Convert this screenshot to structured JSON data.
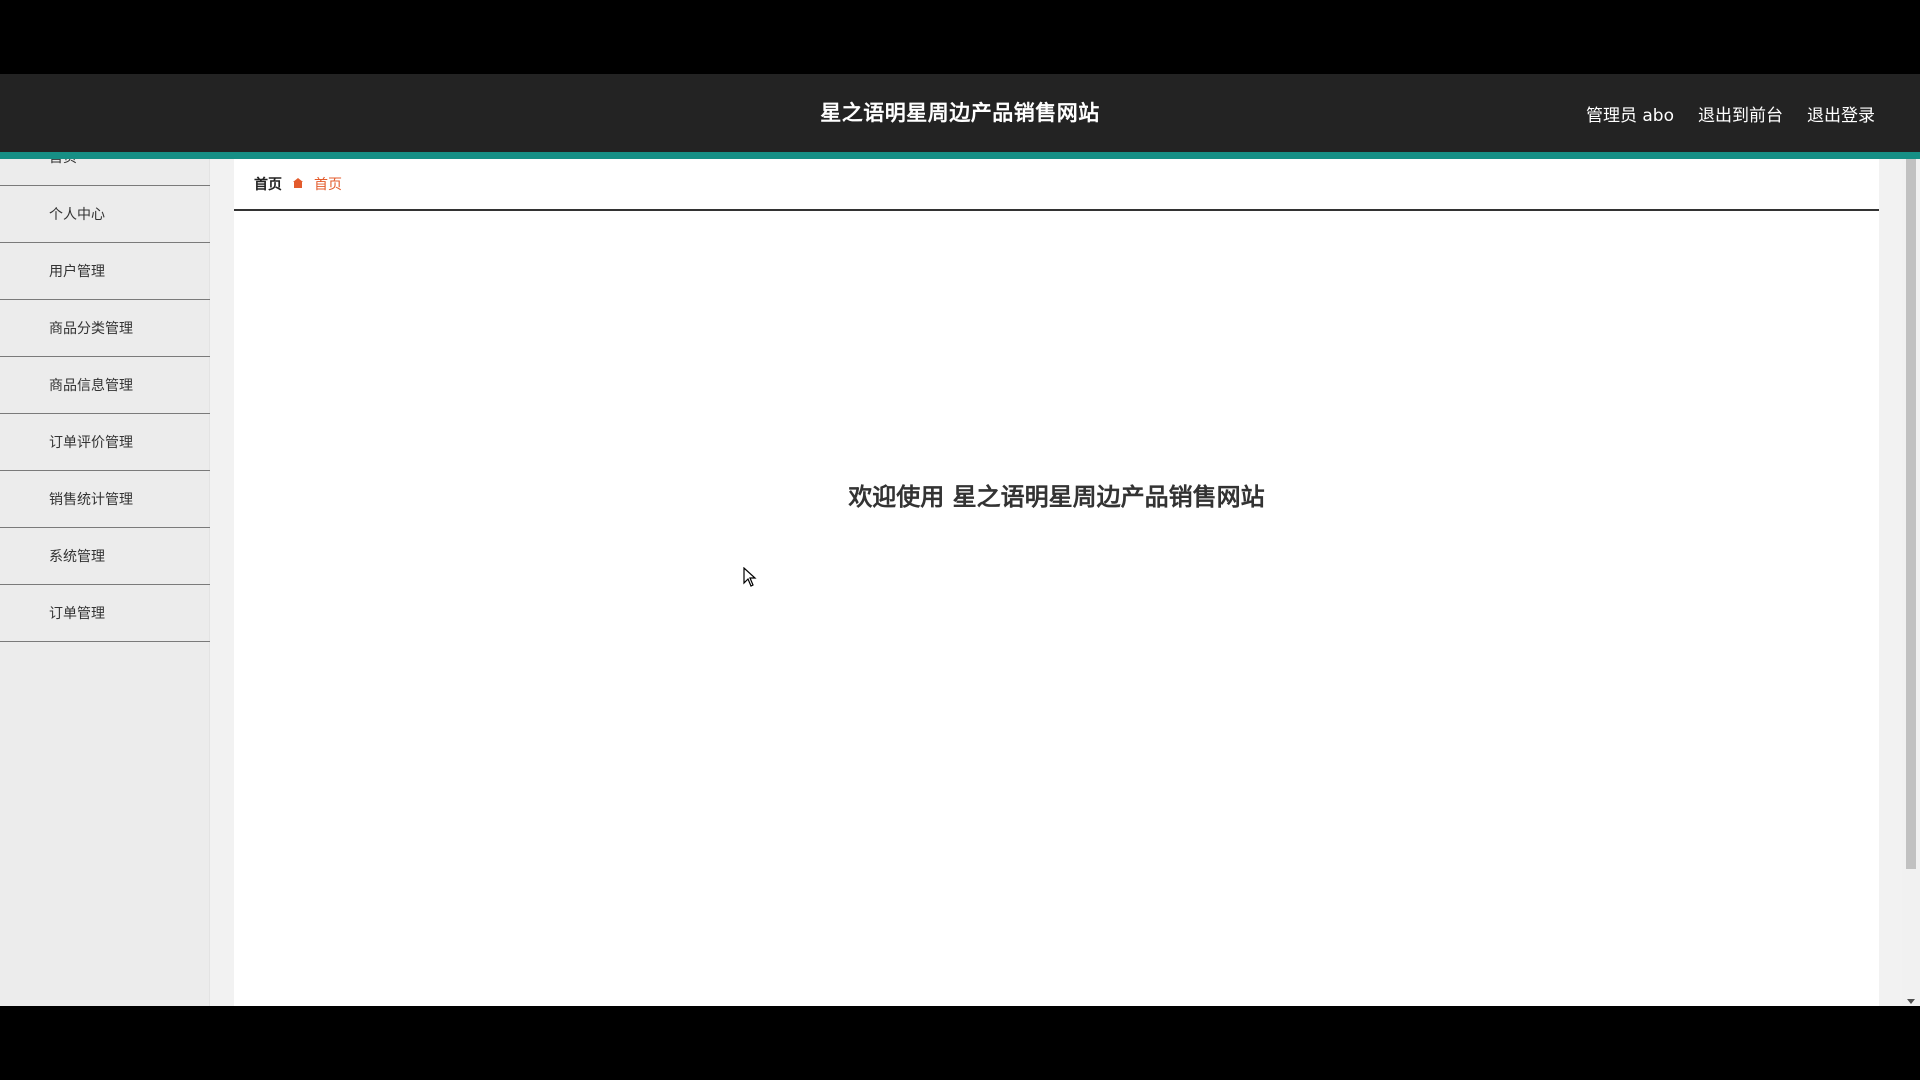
{
  "header": {
    "title": "星之语明星周边产品销售网站",
    "admin_label": "管理员 abo",
    "back_to_front": "退出到前台",
    "logout": "退出登录"
  },
  "sidebar": {
    "items": [
      {
        "label": "首页"
      },
      {
        "label": "个人中心"
      },
      {
        "label": "用户管理"
      },
      {
        "label": "商品分类管理"
      },
      {
        "label": "商品信息管理"
      },
      {
        "label": "订单评价管理"
      },
      {
        "label": "销售统计管理"
      },
      {
        "label": "系统管理"
      },
      {
        "label": "订单管理"
      }
    ]
  },
  "breadcrumb": {
    "home": "首页",
    "current": "首页"
  },
  "main": {
    "welcome": "欢迎使用 星之语明星周边产品销售网站"
  },
  "colors": {
    "header_bg": "#232323",
    "accent": "#168f85",
    "breadcrumb_active": "#e35b2c"
  },
  "icons": {
    "breadcrumb_separator": "home-icon",
    "cursor": "mouse-pointer-icon"
  }
}
